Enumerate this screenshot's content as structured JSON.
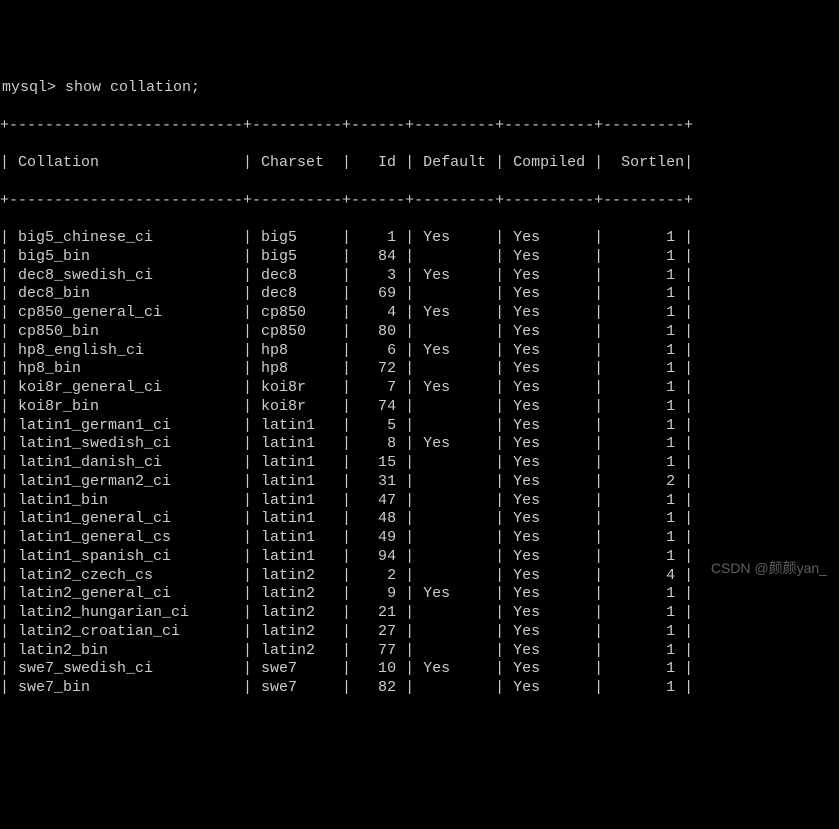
{
  "prompt": "mysql> show collation;",
  "headers": {
    "collation": "Collation",
    "charset": "Charset",
    "id": "Id",
    "default": "Default",
    "compiled": "Compiled",
    "sortlen": "Sortlen"
  },
  "rows": [
    {
      "collation": "big5_chinese_ci",
      "charset": "big5",
      "id": "1",
      "default": "Yes",
      "compiled": "Yes",
      "sortlen": "1"
    },
    {
      "collation": "big5_bin",
      "charset": "big5",
      "id": "84",
      "default": "",
      "compiled": "Yes",
      "sortlen": "1"
    },
    {
      "collation": "dec8_swedish_ci",
      "charset": "dec8",
      "id": "3",
      "default": "Yes",
      "compiled": "Yes",
      "sortlen": "1"
    },
    {
      "collation": "dec8_bin",
      "charset": "dec8",
      "id": "69",
      "default": "",
      "compiled": "Yes",
      "sortlen": "1"
    },
    {
      "collation": "cp850_general_ci",
      "charset": "cp850",
      "id": "4",
      "default": "Yes",
      "compiled": "Yes",
      "sortlen": "1"
    },
    {
      "collation": "cp850_bin",
      "charset": "cp850",
      "id": "80",
      "default": "",
      "compiled": "Yes",
      "sortlen": "1"
    },
    {
      "collation": "hp8_english_ci",
      "charset": "hp8",
      "id": "6",
      "default": "Yes",
      "compiled": "Yes",
      "sortlen": "1"
    },
    {
      "collation": "hp8_bin",
      "charset": "hp8",
      "id": "72",
      "default": "",
      "compiled": "Yes",
      "sortlen": "1"
    },
    {
      "collation": "koi8r_general_ci",
      "charset": "koi8r",
      "id": "7",
      "default": "Yes",
      "compiled": "Yes",
      "sortlen": "1"
    },
    {
      "collation": "koi8r_bin",
      "charset": "koi8r",
      "id": "74",
      "default": "",
      "compiled": "Yes",
      "sortlen": "1"
    },
    {
      "collation": "latin1_german1_ci",
      "charset": "latin1",
      "id": "5",
      "default": "",
      "compiled": "Yes",
      "sortlen": "1"
    },
    {
      "collation": "latin1_swedish_ci",
      "charset": "latin1",
      "id": "8",
      "default": "Yes",
      "compiled": "Yes",
      "sortlen": "1"
    },
    {
      "collation": "latin1_danish_ci",
      "charset": "latin1",
      "id": "15",
      "default": "",
      "compiled": "Yes",
      "sortlen": "1"
    },
    {
      "collation": "latin1_german2_ci",
      "charset": "latin1",
      "id": "31",
      "default": "",
      "compiled": "Yes",
      "sortlen": "2"
    },
    {
      "collation": "latin1_bin",
      "charset": "latin1",
      "id": "47",
      "default": "",
      "compiled": "Yes",
      "sortlen": "1"
    },
    {
      "collation": "latin1_general_ci",
      "charset": "latin1",
      "id": "48",
      "default": "",
      "compiled": "Yes",
      "sortlen": "1"
    },
    {
      "collation": "latin1_general_cs",
      "charset": "latin1",
      "id": "49",
      "default": "",
      "compiled": "Yes",
      "sortlen": "1"
    },
    {
      "collation": "latin1_spanish_ci",
      "charset": "latin1",
      "id": "94",
      "default": "",
      "compiled": "Yes",
      "sortlen": "1"
    },
    {
      "collation": "latin2_czech_cs",
      "charset": "latin2",
      "id": "2",
      "default": "",
      "compiled": "Yes",
      "sortlen": "4"
    },
    {
      "collation": "latin2_general_ci",
      "charset": "latin2",
      "id": "9",
      "default": "Yes",
      "compiled": "Yes",
      "sortlen": "1"
    },
    {
      "collation": "latin2_hungarian_ci",
      "charset": "latin2",
      "id": "21",
      "default": "",
      "compiled": "Yes",
      "sortlen": "1"
    },
    {
      "collation": "latin2_croatian_ci",
      "charset": "latin2",
      "id": "27",
      "default": "",
      "compiled": "Yes",
      "sortlen": "1"
    },
    {
      "collation": "latin2_bin",
      "charset": "latin2",
      "id": "77",
      "default": "",
      "compiled": "Yes",
      "sortlen": "1"
    },
    {
      "collation": "swe7_swedish_ci",
      "charset": "swe7",
      "id": "10",
      "default": "Yes",
      "compiled": "Yes",
      "sortlen": "1"
    },
    {
      "collation": "swe7_bin",
      "charset": "swe7",
      "id": "82",
      "default": "",
      "compiled": "Yes",
      "sortlen": "1"
    }
  ],
  "watermark": "CSDN @颜颜yan_",
  "border_segments": {
    "collation": "--------------------------",
    "charset": "----------",
    "id": "------",
    "default": "---------",
    "compiled": "----------",
    "sortlen": "---------"
  }
}
